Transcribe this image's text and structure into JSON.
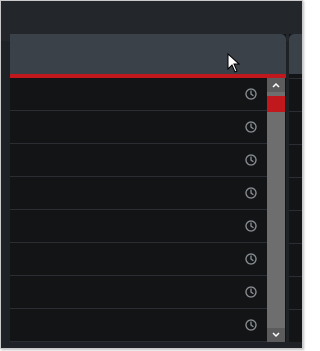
{
  "panel": {
    "header_title": "",
    "accent_color": "#c0181d",
    "row_count": 7,
    "row_icon": "clock-icon"
  },
  "scrollbar": {
    "up_icon": "chevron-up-icon",
    "down_icon": "chevron-down-icon",
    "thumb_color": "#c0181d"
  },
  "cursor": {
    "icon": "pointer-cursor-icon"
  }
}
